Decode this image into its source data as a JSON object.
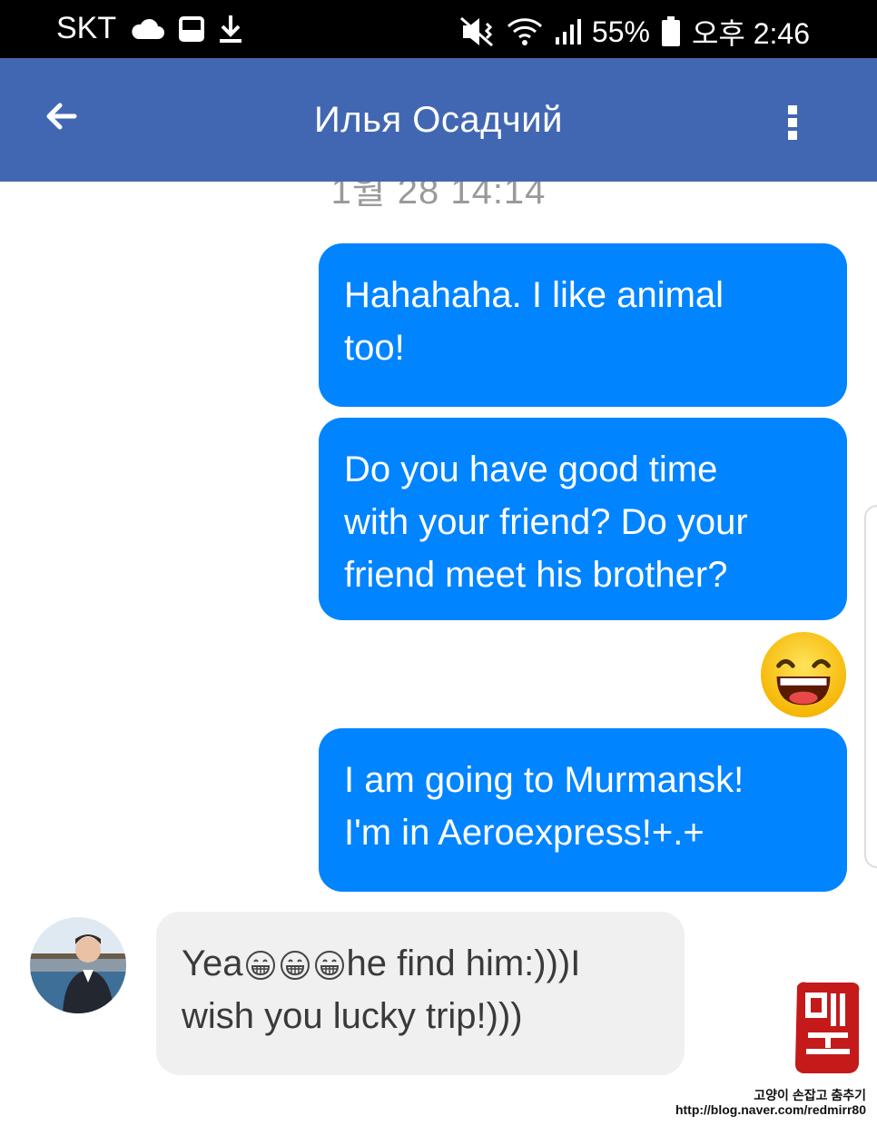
{
  "status_bar": {
    "carrier": "SKT",
    "battery": "55%",
    "time": "오후 2:46"
  },
  "header": {
    "title": "Илья Осадчий",
    "back_icon": "arrow-left-icon",
    "more_icon": "more-vert-icon",
    "color": "#4267b2"
  },
  "timestamp": "1월 28 14:14",
  "messages": [
    {
      "direction": "outgoing",
      "text": "Hahahaha. I like animal\ntoo!"
    },
    {
      "direction": "outgoing",
      "text": "Do you have good time\nwith your friend? Do your\nfriend meet his brother?"
    },
    {
      "direction": "outgoing",
      "sticker": "laughing-emoji-icon"
    },
    {
      "direction": "outgoing",
      "text": "I am going to Murmansk!\nI'm in Aeroexpress!+.+"
    },
    {
      "direction": "incoming",
      "text_before": "Yea",
      "text_after": "he find him:)))I\nwish you lucky trip!)))",
      "emoji_count": 3
    }
  ],
  "colors": {
    "outgoing_bubble": "#0084ff",
    "incoming_bubble": "#f1f0f0"
  },
  "watermark": {
    "line1": "고양이 손잡고 춤추기",
    "line2": "http://blog.naver.com/redmirr80"
  }
}
